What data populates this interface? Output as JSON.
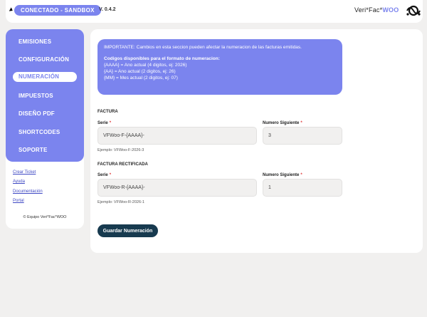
{
  "header": {
    "env_badge": "CONECTADO - SANDBOX",
    "version": "V. 0.4.2",
    "brand_prefix": "Veri*Fac*",
    "brand_suffix": "WOO"
  },
  "sidebar": {
    "items": [
      {
        "label": "EMISIONES"
      },
      {
        "label": "CONFIGURACIÓN"
      },
      {
        "label": "NUMERACIÓN"
      },
      {
        "label": "IMPUESTOS"
      },
      {
        "label": "DISEÑO PDF"
      },
      {
        "label": "SHORTCODES"
      },
      {
        "label": "SOPORTE"
      }
    ],
    "active": "NUMERACIÓN",
    "links": [
      {
        "label": "Crear Ticket"
      },
      {
        "label": "Ayuda"
      },
      {
        "label": "Documentación"
      },
      {
        "label": "Portal"
      }
    ],
    "footer": "© Equipo Veri*Fac*WOO"
  },
  "info": {
    "warning": "IMPORTANTE: Cambios en esta seccion pueden afectar la numeracion de las facturas emitidas.",
    "codes_title": "Codigos disponibles para el formato de numeracion:",
    "codes": [
      "{AAAA} = Ano actual (4 digitos, ej: 2026)",
      "{AA} = Ano actual (2 digitos, ej: 26)",
      "{MM} = Mes actual (2 digitos, ej: 07)"
    ]
  },
  "factura": {
    "title": "FACTURA",
    "serie_label": "Serie",
    "serie_value": "VFWoo-F-{AAAA}-",
    "next_label": "Numero Siguiente",
    "next_value": "3",
    "example": "Ejemplo: VFWoo-F-2026-3"
  },
  "rectificada": {
    "title": "FACTURA RECTIFICADA",
    "serie_label": "Serie",
    "serie_value": "VFWoo-R-{AAAA}-",
    "next_label": "Numero Siguiente",
    "next_value": "1",
    "example": "Ejemplo: VFWoo-R-2026-1"
  },
  "actions": {
    "save_label": "Guardar Numeración"
  },
  "colors": {
    "accent": "#7b84ee",
    "button": "#173a4f",
    "required": "#e03c3c"
  }
}
